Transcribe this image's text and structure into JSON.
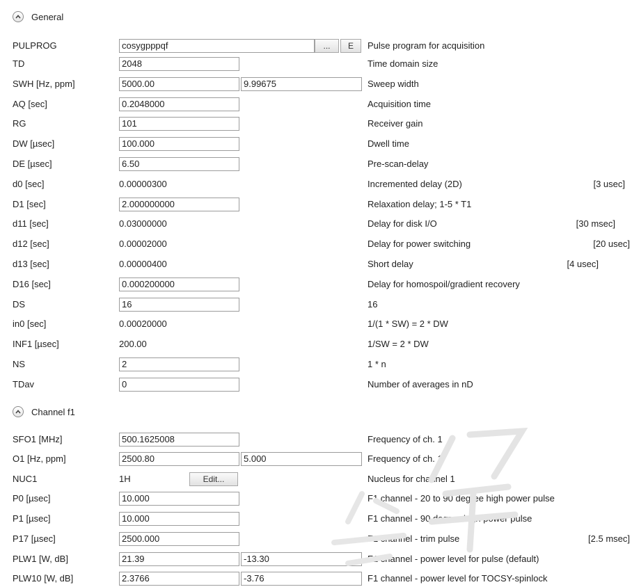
{
  "sections": {
    "general": "General",
    "channel_f1": "Channel f1"
  },
  "buttons": {
    "browse": "...",
    "edit_e": "E",
    "edit_nuc": "Edit..."
  },
  "rows": {
    "pulprog": {
      "label": "PULPROG",
      "value": "cosygpppqf",
      "desc": "Pulse program for acquisition"
    },
    "td": {
      "label": "TD",
      "value": "2048",
      "desc": "Time domain size"
    },
    "swh": {
      "label": "SWH [Hz, ppm]",
      "value": "5000.00",
      "value2": "9.99675",
      "desc": "Sweep width"
    },
    "aq": {
      "label": "AQ [sec]",
      "value": "0.2048000",
      "desc": "Acquisition time"
    },
    "rg": {
      "label": "RG",
      "value": "101",
      "desc": "Receiver gain"
    },
    "dw": {
      "label": "DW [µsec]",
      "value": "100.000",
      "desc": "Dwell time"
    },
    "de": {
      "label": "DE [µsec]",
      "value": "6.50",
      "desc": "Pre-scan-delay"
    },
    "d0": {
      "label": "d0 [sec]",
      "value": "0.00000300",
      "desc": "Incremented delay (2D)",
      "unit": "[3 usec]"
    },
    "d1": {
      "label": "D1 [sec]",
      "value": "2.000000000",
      "desc": "Relaxation delay; 1-5 * T1"
    },
    "d11": {
      "label": "d11 [sec]",
      "value": "0.03000000",
      "desc": "Delay for disk I/O",
      "unit": "[30 msec]"
    },
    "d12": {
      "label": "d12 [sec]",
      "value": "0.00002000",
      "desc": "Delay for power switching",
      "unit": "[20 usec]"
    },
    "d13": {
      "label": "d13 [sec]",
      "value": "0.00000400",
      "desc": "Short delay",
      "unit": "[4 usec]"
    },
    "d16": {
      "label": "D16 [sec]",
      "value": "0.000200000",
      "desc": "Delay for homospoil/gradient recovery"
    },
    "ds": {
      "label": "DS",
      "value": "16",
      "desc": "16"
    },
    "in0": {
      "label": "in0 [sec]",
      "value": "0.00020000",
      "desc": "1/(1 * SW) = 2 * DW"
    },
    "inf1": {
      "label": "INF1 [µsec]",
      "value": "200.00",
      "desc": "1/SW = 2 * DW"
    },
    "ns": {
      "label": "NS",
      "value": "2",
      "desc": "1 * n"
    },
    "tdav": {
      "label": "TDav",
      "value": "0",
      "desc": "Number of averages in nD"
    },
    "sfo1": {
      "label": "SFO1 [MHz]",
      "value": "500.1625008",
      "desc": "Frequency of ch. 1"
    },
    "o1": {
      "label": "O1 [Hz, ppm]",
      "value": "2500.80",
      "value2": "5.000",
      "desc": "Frequency of ch. 1"
    },
    "nuc1": {
      "label": "NUC1",
      "value": "1H",
      "desc": "Nucleus for channel 1"
    },
    "p0": {
      "label": "P0 [µsec]",
      "value": "10.000",
      "desc": "F1 channel -  20 to 90 degree high power pulse"
    },
    "p1": {
      "label": "P1 [µsec]",
      "value": "10.000",
      "desc": "F1 channel -  90 degree high power pulse"
    },
    "p17": {
      "label": "P17 [µsec]",
      "value": "2500.000",
      "desc": "F1 channel - trim pulse",
      "unit": "[2.5 msec]"
    },
    "plw1": {
      "label": "PLW1 [W, dB]",
      "value": "21.39",
      "value2": "-13.30",
      "desc": "F1 channel - power level for pulse (default)"
    },
    "plw10": {
      "label": "PLW10 [W, dB]",
      "value": "2.3766",
      "value2": "-3.76",
      "desc": "F1 channel - power level for TOCSY-spinlock"
    }
  }
}
